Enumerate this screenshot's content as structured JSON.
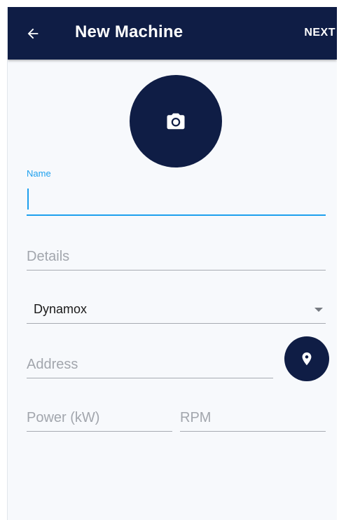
{
  "appbar": {
    "title": "New Machine",
    "next_label": "NEXT",
    "background_color": "#0f1d45",
    "back_icon": "arrow-left-icon"
  },
  "photo": {
    "icon": "camera-icon"
  },
  "form": {
    "name": {
      "label": "Name",
      "value": "",
      "accent_color": "#1ea0ee"
    },
    "details": {
      "placeholder": "Details",
      "value": ""
    },
    "brand_select": {
      "selected": "Dynamox"
    },
    "address": {
      "placeholder": "Address",
      "value": "",
      "location_icon": "map-pin-icon"
    },
    "power": {
      "placeholder": "Power (kW)",
      "value": ""
    },
    "rpm": {
      "placeholder": "RPM",
      "value": ""
    }
  }
}
